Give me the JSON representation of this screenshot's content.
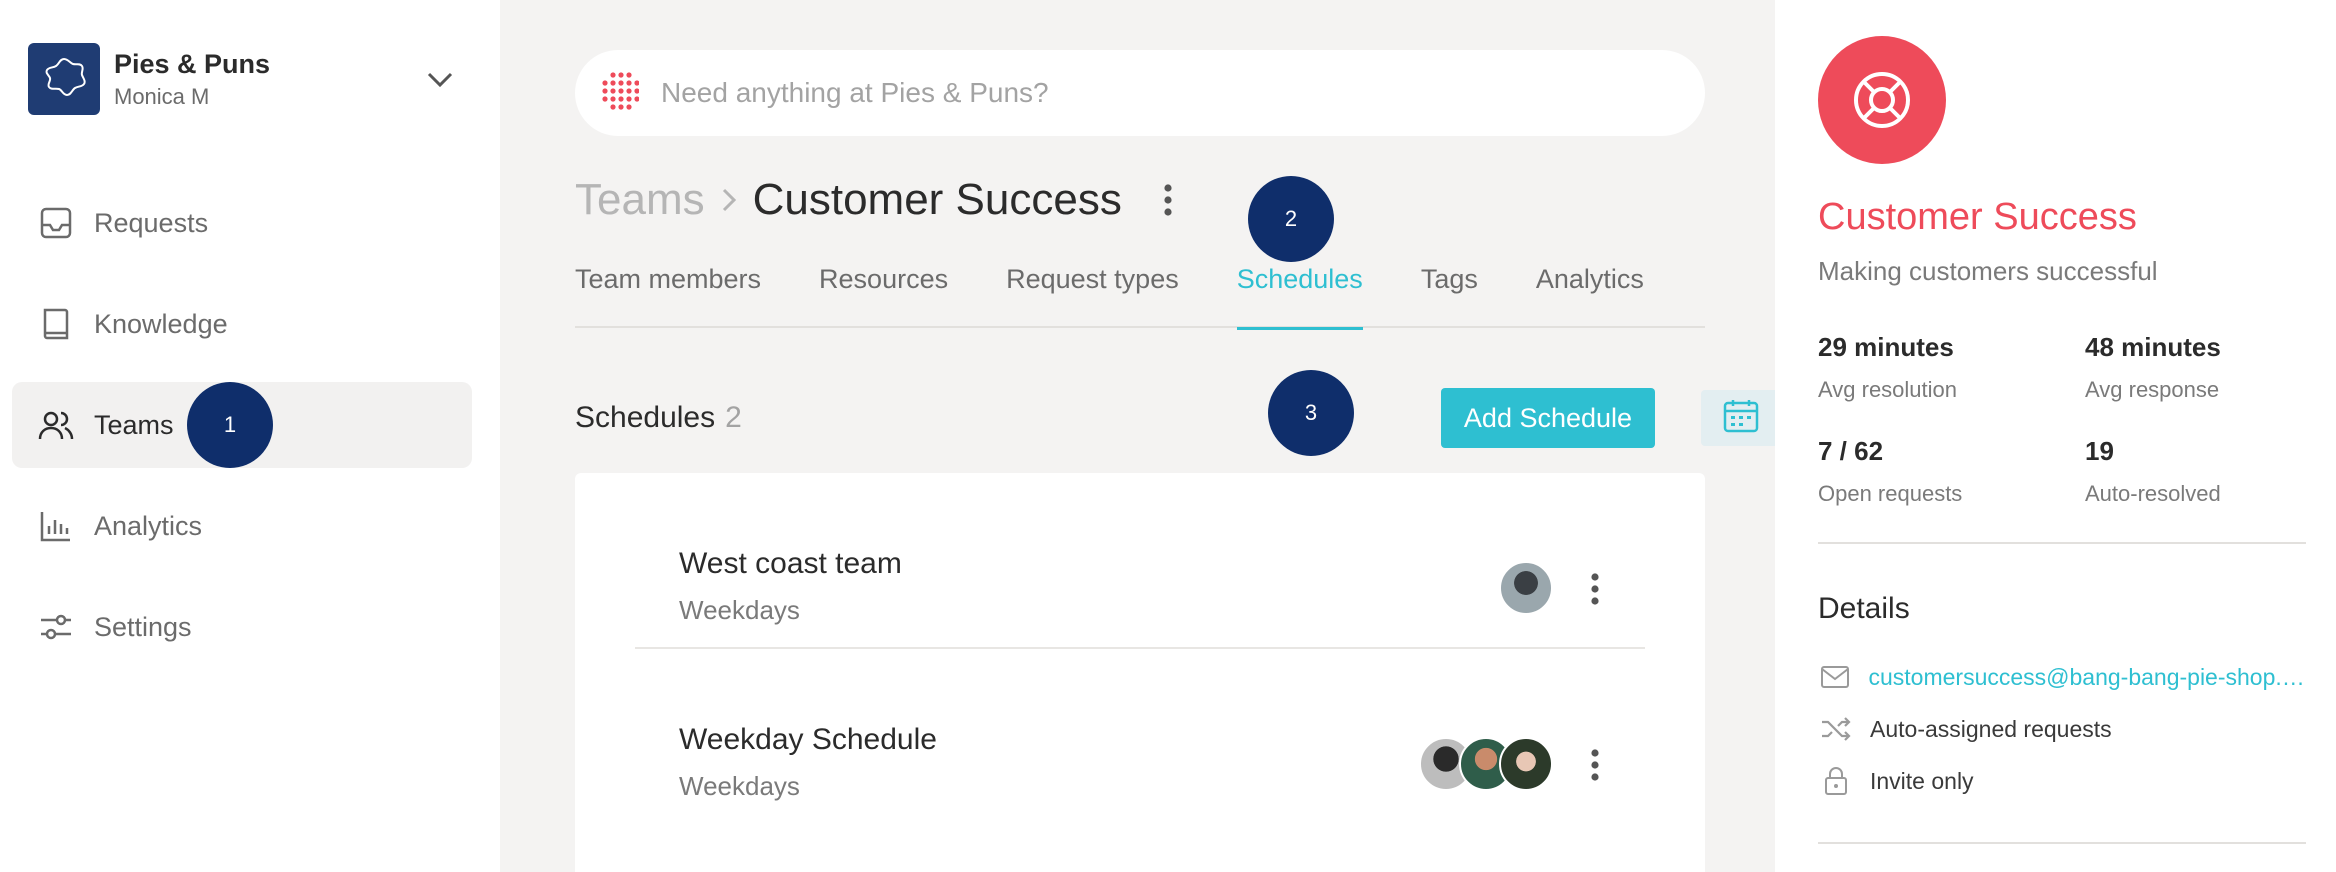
{
  "workspace": {
    "name": "Pies & Puns",
    "user": "Monica M"
  },
  "nav": {
    "items": [
      {
        "label": "Requests",
        "icon": "inbox-icon"
      },
      {
        "label": "Knowledge",
        "icon": "book-icon"
      },
      {
        "label": "Teams",
        "icon": "users-icon",
        "active": true
      },
      {
        "label": "Analytics",
        "icon": "bar-chart-icon"
      },
      {
        "label": "Settings",
        "icon": "sliders-icon"
      }
    ]
  },
  "badges": [
    "1",
    "2",
    "3"
  ],
  "search": {
    "placeholder": "Need anything at Pies & Puns?"
  },
  "breadcrumb": {
    "parent": "Teams",
    "current": "Customer Success"
  },
  "tabs": [
    "Team members",
    "Resources",
    "Request types",
    "Schedules",
    "Tags",
    "Analytics"
  ],
  "active_tab": "Schedules",
  "schedules": {
    "title": "Schedules",
    "count": "2",
    "add_label": "Add Schedule",
    "rows": [
      {
        "name": "West coast team",
        "sub": "Weekdays",
        "avatars": 1
      },
      {
        "name": "Weekday Schedule",
        "sub": "Weekdays",
        "avatars": 3
      }
    ]
  },
  "panel": {
    "title": "Customer Success",
    "subtitle": "Making customers successful",
    "stats": [
      {
        "value": "29 minutes",
        "label": "Avg resolution"
      },
      {
        "value": "48 minutes",
        "label": "Avg response"
      },
      {
        "value": "7 / 62",
        "label": "Open requests"
      },
      {
        "value": "19",
        "label": "Auto-resolved"
      }
    ],
    "details_title": "Details",
    "details": [
      {
        "icon": "mail-icon",
        "text": "customersuccess@bang-bang-pie-shop.com"
      },
      {
        "icon": "shuffle-icon",
        "text": "Auto-assigned requests"
      },
      {
        "icon": "lock-icon",
        "text": "Invite only"
      }
    ]
  },
  "colors": {
    "accent": "#2ebfd1",
    "brand_red": "#ee4b5a",
    "navy": "#0f2e6b",
    "workspace_blue": "#1f3c73"
  }
}
